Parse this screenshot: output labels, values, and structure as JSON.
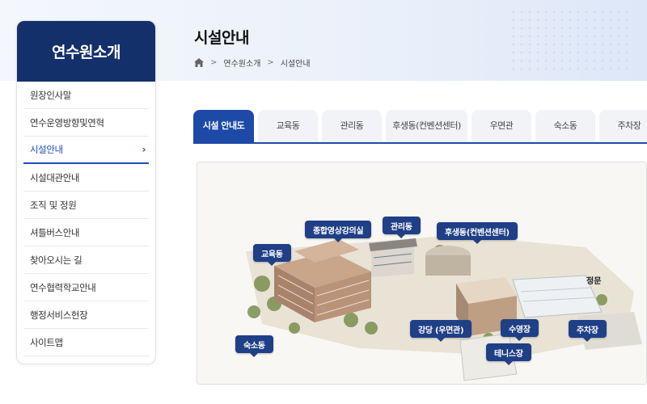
{
  "sidebar": {
    "title": "연수원소개",
    "items": [
      {
        "label": "원장인사말"
      },
      {
        "label": "연수운영방향및연혁"
      },
      {
        "label": "시설안내",
        "active": true
      },
      {
        "label": "시설대관안내"
      },
      {
        "label": "조직 및 정원"
      },
      {
        "label": "셔틀버스안내"
      },
      {
        "label": "찾아오시는 길"
      },
      {
        "label": "연수협력학교안내"
      },
      {
        "label": "행정서비스헌장"
      },
      {
        "label": "사이트맵"
      }
    ]
  },
  "page": {
    "title": "시설안내"
  },
  "breadcrumb": {
    "items": [
      "연수원소개",
      "시설안내"
    ],
    "separator": ">"
  },
  "tabs": [
    {
      "label": "시설 안내도",
      "active": true
    },
    {
      "label": "교육동"
    },
    {
      "label": "관리동"
    },
    {
      "label": "후생동(컨벤션센터)"
    },
    {
      "label": "우면관"
    },
    {
      "label": "숙소동"
    },
    {
      "label": "주차장"
    }
  ],
  "map": {
    "labels": {
      "gyoyuk": "교육동",
      "media": "종합영상강의실",
      "admin": "관리동",
      "welfare": "후생동(컨벤션센터)",
      "dorm": "숙소동",
      "auditorium": "강당 (우면관)",
      "pool": "수영장",
      "parking": "주차장",
      "tennis": "테니스장",
      "gate": "정문"
    }
  },
  "colors": {
    "primary": "#1d4aa7",
    "sidebar_header": "#14306b",
    "label_bg": "#1f3f86",
    "active_text": "#1c4fb8"
  },
  "icons": {
    "home": "home-icon",
    "chevron": "chevron-right-icon"
  }
}
